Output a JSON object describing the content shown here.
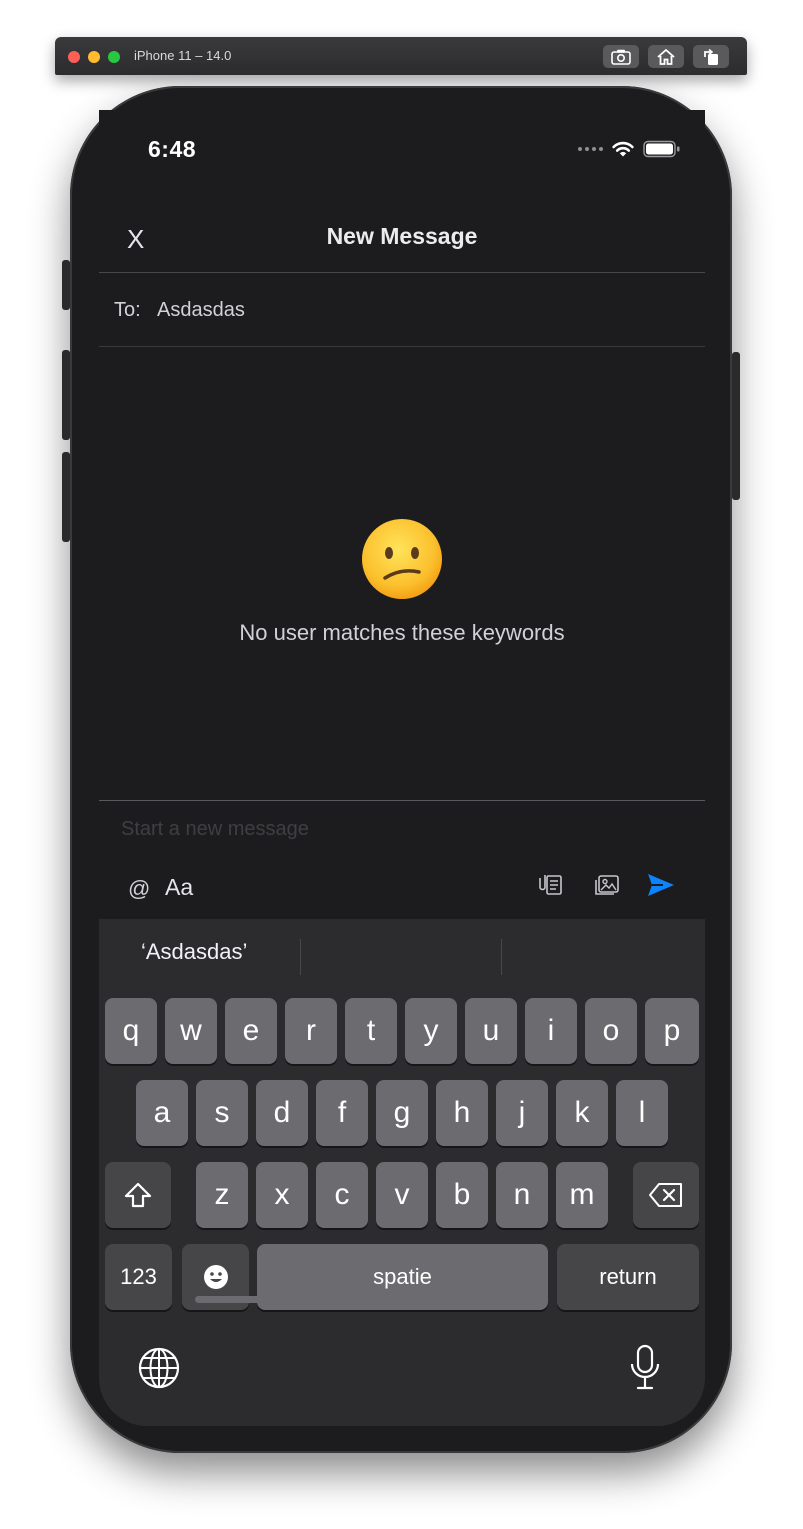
{
  "simulator": {
    "title": "iPhone 11 – 14.0"
  },
  "status_bar": {
    "time": "6:48"
  },
  "nav": {
    "close_label": "X",
    "title": "New Message"
  },
  "to_field": {
    "label": "To:",
    "value": "Asdasdas"
  },
  "empty_state": {
    "emoji": "😕",
    "message": "No user matches these keywords"
  },
  "composer": {
    "placeholder": "Start a new message"
  },
  "toolbar": {
    "mention_label": "@",
    "format_label": "Aa",
    "accent_color": "#0a84ff"
  },
  "keyboard": {
    "suggestions": [
      "‘Asdasdas’",
      "",
      ""
    ],
    "row1": [
      "q",
      "w",
      "e",
      "r",
      "t",
      "y",
      "u",
      "i",
      "o",
      "p"
    ],
    "row2": [
      "a",
      "s",
      "d",
      "f",
      "g",
      "h",
      "j",
      "k",
      "l"
    ],
    "row3": [
      "z",
      "x",
      "c",
      "v",
      "b",
      "n",
      "m"
    ],
    "numbers_label": "123",
    "space_label": "spatie",
    "return_label": "return"
  }
}
